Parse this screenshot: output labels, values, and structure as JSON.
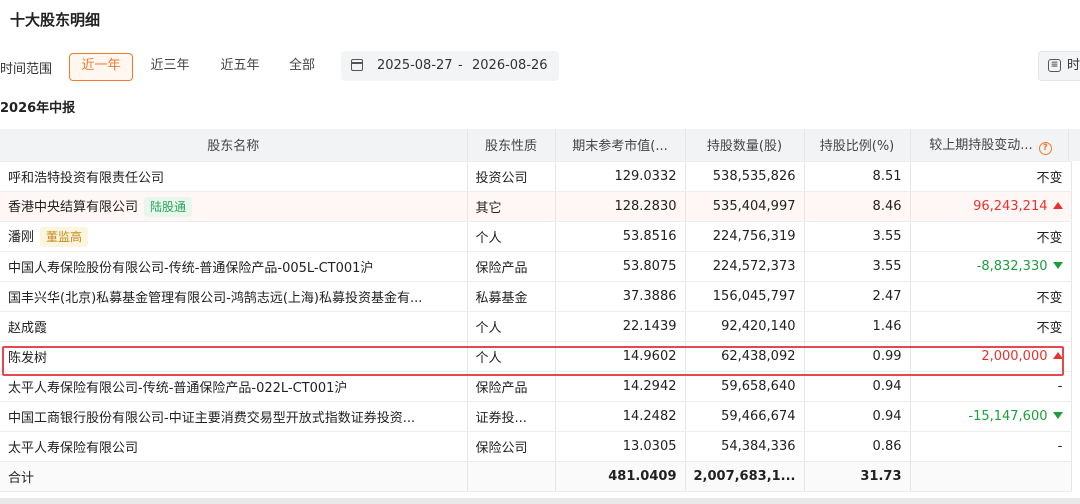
{
  "page_title": "十大股东明细",
  "filters": {
    "range_label": "时间范围",
    "tabs": [
      {
        "label": "近一年",
        "active": true
      },
      {
        "label": "近三年",
        "active": false
      },
      {
        "label": "近五年",
        "active": false
      },
      {
        "label": "全部",
        "active": false
      }
    ],
    "date_start": "2025-08-27",
    "date_separator": "-",
    "date_end": "2026-08-26",
    "right_button_label": "时"
  },
  "section_title": "2026年中报",
  "table": {
    "headers": [
      "股东名称",
      "股东性质",
      "期末参考市值(...",
      "持股数量(股)",
      "持股比例(%)",
      "较上期持股变动..."
    ],
    "rows": [
      {
        "name": "呼和浩特投资有限责任公司",
        "tag": "",
        "nature": "投资公司",
        "value": "129.0332",
        "shares": "538,535,826",
        "ratio": "8.51",
        "change": "不变",
        "dir": "none"
      },
      {
        "name": "香港中央结算有限公司",
        "tag": "陆股通",
        "nature": "其它",
        "value": "128.2830",
        "shares": "535,404,997",
        "ratio": "8.46",
        "change": "96,243,214",
        "dir": "up"
      },
      {
        "name": "潘刚",
        "tag": "董监高",
        "nature": "个人",
        "value": "53.8516",
        "shares": "224,756,319",
        "ratio": "3.55",
        "change": "不变",
        "dir": "none"
      },
      {
        "name": "中国人寿保险股份有限公司-传统-普通保险产品-005L-CT001沪",
        "tag": "",
        "nature": "保险产品",
        "value": "53.8075",
        "shares": "224,572,373",
        "ratio": "3.55",
        "change": "-8,832,330",
        "dir": "down"
      },
      {
        "name": "国丰兴华(北京)私募基金管理有限公司-鸿鹄志远(上海)私募投资基金有...",
        "tag": "",
        "nature": "私募基金",
        "value": "37.3886",
        "shares": "156,045,797",
        "ratio": "2.47",
        "change": "不变",
        "dir": "none"
      },
      {
        "name": "赵成霞",
        "tag": "",
        "nature": "个人",
        "value": "22.1439",
        "shares": "92,420,140",
        "ratio": "1.46",
        "change": "不变",
        "dir": "none"
      },
      {
        "name": "陈发树",
        "tag": "",
        "nature": "个人",
        "value": "14.9602",
        "shares": "62,438,092",
        "ratio": "0.99",
        "change": "2,000,000",
        "dir": "up"
      },
      {
        "name": "太平人寿保险有限公司-传统-普通保险产品-022L-CT001沪",
        "tag": "",
        "nature": "保险产品",
        "value": "14.2942",
        "shares": "59,658,640",
        "ratio": "0.94",
        "change": "-",
        "dir": "none"
      },
      {
        "name": "中国工商银行股份有限公司-中证主要消费交易型开放式指数证券投资...",
        "tag": "",
        "nature": "证券投...",
        "value": "14.2482",
        "shares": "59,466,674",
        "ratio": "0.94",
        "change": "-15,147,600",
        "dir": "down"
      },
      {
        "name": "太平人寿保险有限公司",
        "tag": "",
        "nature": "保险公司",
        "value": "13.0305",
        "shares": "54,384,336",
        "ratio": "0.86",
        "change": "-",
        "dir": "none"
      }
    ],
    "total": {
      "label": "合计",
      "value": "481.0409",
      "shares": "2,007,683,1...",
      "ratio": "31.73"
    }
  }
}
